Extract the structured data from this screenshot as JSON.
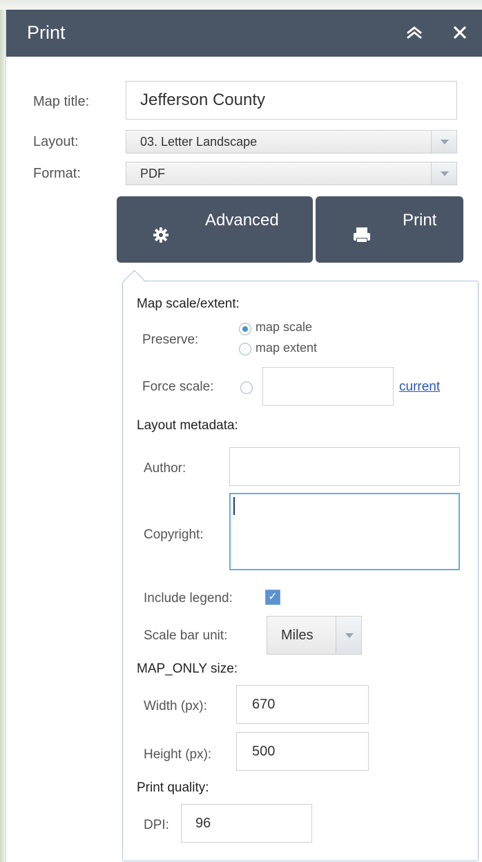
{
  "header": {
    "title": "Print",
    "collapse_icon": "double-chevron-up-icon",
    "close_icon": "close-icon"
  },
  "form": {
    "map_title_label": "Map title:",
    "map_title_value": "Jefferson County",
    "layout_label": "Layout:",
    "layout_value": "03. Letter Landscape",
    "format_label": "Format:",
    "format_value": "PDF"
  },
  "buttons": {
    "advanced_label": "Advanced",
    "advanced_icon": "gear-icon",
    "print_label": "Print",
    "print_icon": "printer-icon"
  },
  "advanced": {
    "map_scale_section": "Map scale/extent:",
    "preserve_label": "Preserve:",
    "preserve_options": [
      "map scale",
      "map extent"
    ],
    "preserve_selected": "map scale",
    "force_scale_label": "Force scale:",
    "force_scale_value": "",
    "current_link": "current",
    "layout_metadata_section": "Layout metadata:",
    "author_label": "Author:",
    "author_value": "",
    "copyright_label": "Copyright:",
    "copyright_value": "",
    "include_legend_label": "Include legend:",
    "include_legend_checked": true,
    "scale_bar_unit_label": "Scale bar unit:",
    "scale_bar_unit_value": "Miles",
    "map_only_section": "MAP_ONLY size:",
    "width_label": "Width (px):",
    "width_value": "670",
    "height_label": "Height (px):",
    "height_value": "500",
    "print_quality_section": "Print quality:",
    "dpi_label": "DPI:",
    "dpi_value": "96"
  },
  "colors": {
    "header_bg": "#4a5666",
    "accent_blue": "#4d8fd0",
    "link_blue": "#2a56c6"
  }
}
